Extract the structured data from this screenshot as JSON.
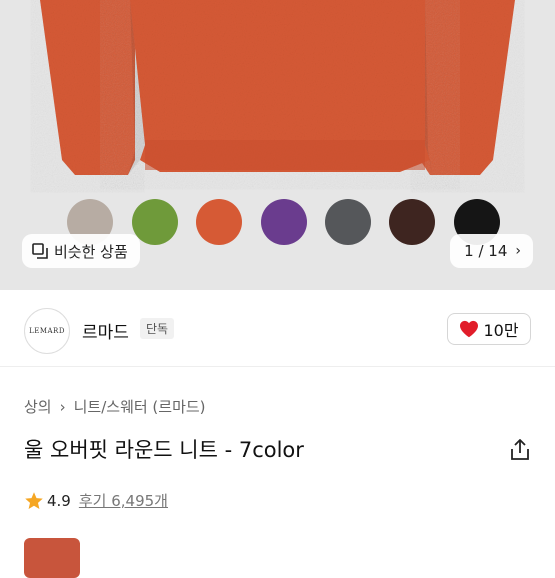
{
  "gallery": {
    "similar_label": "비슷한 상품",
    "counter": "1 / 14",
    "swatches": [
      {
        "name": "oatmeal",
        "color": "#b7aca3"
      },
      {
        "name": "green",
        "color": "#6f9a3a"
      },
      {
        "name": "orange",
        "color": "#d65a35"
      },
      {
        "name": "purple",
        "color": "#6a3c8e"
      },
      {
        "name": "charcoal",
        "color": "#55575a"
      },
      {
        "name": "brown",
        "color": "#3e2520"
      },
      {
        "name": "black",
        "color": "#151515"
      }
    ]
  },
  "seller": {
    "logo_text": "LEMARD",
    "name": "르마드",
    "badge": "단독",
    "like_count": "10만"
  },
  "breadcrumb": {
    "level1": "상의",
    "level2": "니트/스웨터 (르마드)"
  },
  "product": {
    "title": "울 오버핏 라운드 니트 - 7color",
    "rating": "4.9",
    "reviews_label": "후기 6,495개"
  },
  "colors": {
    "heart": "#e11d2a",
    "star": "#f5a623",
    "sweater": "#d65a35"
  }
}
